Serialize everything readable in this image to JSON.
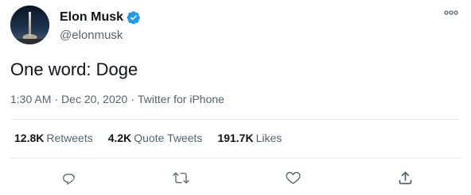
{
  "author": {
    "name": "Elon Musk",
    "handle": "@elonmusk",
    "verified": true,
    "avatar_icon": "rocket-launch-avatar"
  },
  "tweet": {
    "text": "One word: Doge",
    "time": "1:30 AM",
    "separator": "·",
    "date": "Dec 20, 2020",
    "source": "Twitter for iPhone"
  },
  "stats": {
    "retweets": {
      "count": "12.8K",
      "label": "Retweets"
    },
    "quote_tweets": {
      "count": "4.2K",
      "label": "Quote Tweets"
    },
    "likes": {
      "count": "191.7K",
      "label": "Likes"
    }
  },
  "actions": {
    "reply_icon": "reply-icon",
    "retweet_icon": "retweet-icon",
    "like_icon": "heart-icon",
    "share_icon": "share-icon"
  },
  "colors": {
    "text_primary": "#0f1419",
    "text_secondary": "#536471",
    "verified_blue": "#1d9bf0",
    "divider": "#e6ecf0"
  }
}
